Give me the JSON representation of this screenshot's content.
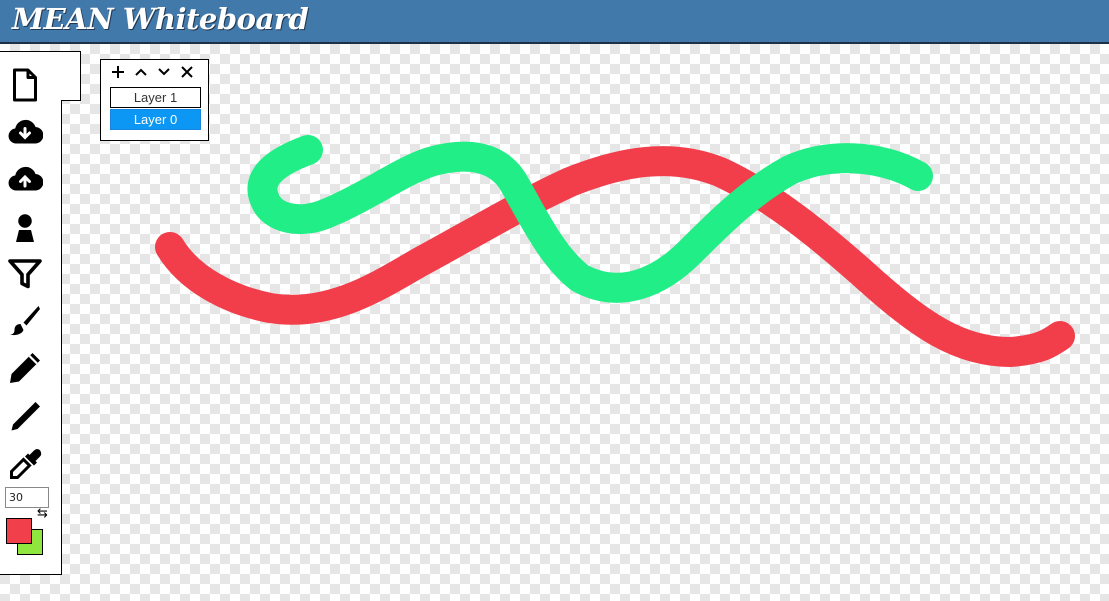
{
  "app": {
    "title": "MEAN Whiteboard"
  },
  "toolbar": {
    "tools": [
      {
        "name": "new-document-icon"
      },
      {
        "name": "cloud-download-icon"
      },
      {
        "name": "cloud-upload-icon"
      },
      {
        "name": "user-icon"
      },
      {
        "name": "fill-icon"
      },
      {
        "name": "paintbrush-icon"
      },
      {
        "name": "pencil-icon"
      },
      {
        "name": "pen-icon"
      },
      {
        "name": "eyedropper-icon"
      }
    ],
    "brush_size": "30",
    "swap_icon": "swap-arrows-icon",
    "primary_color": "#f1404c",
    "secondary_color": "#8ee63e"
  },
  "layers": {
    "controls": [
      "+",
      "^",
      "v",
      "x"
    ],
    "items": [
      {
        "label": "Layer 1",
        "selected": false
      },
      {
        "label": "Layer 0",
        "selected": true
      }
    ]
  },
  "canvas": {
    "strokes": [
      {
        "color": "#f23e4b",
        "width": 30
      },
      {
        "color": "#22ee88",
        "width": 30
      }
    ]
  }
}
